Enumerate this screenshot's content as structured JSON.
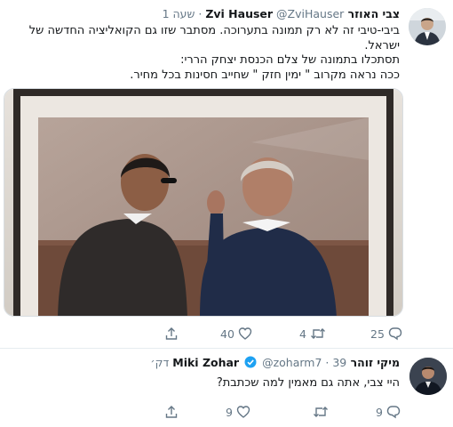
{
  "tweet1": {
    "author_name": "צבי האוזר Zvi Hauser",
    "handle": "@ZviHauser",
    "separator": "·",
    "time": "שעה 1",
    "lines": [
      "ביבי-טיבי זה לא רק תמונה בתערוכה. מסתבר שזו גם הקואליציה החדשה של",
      "ישראל.",
      "תסתכלו בתמונה של צלם הכנסת יצחק הררי:",
      "ככה נראה מקרוב \" ימין חזק \" שחייב חסינות בכל מחיר."
    ],
    "reply_count": "25",
    "retweet_count": "4",
    "like_count": "40",
    "icons": [
      "reply-icon",
      "retweet-icon",
      "like-icon",
      "share-icon"
    ]
  },
  "tweet2": {
    "author_name": "מיקי זוהר Miki Zohar",
    "handle": "@zoharm7",
    "separator": "·",
    "time": "39 דק׳",
    "text": "היי צבי, אתה גם מאמין למה שכתבת?",
    "reply_count": "9",
    "retweet_count": "",
    "like_count": "9",
    "verified": true,
    "icons": [
      "reply-icon",
      "retweet-icon",
      "like-icon",
      "share-icon"
    ]
  },
  "colors": {
    "text": "#14171a",
    "secondary": "#657786",
    "verified": "#1da1f2",
    "divider": "#e6ecf0"
  }
}
